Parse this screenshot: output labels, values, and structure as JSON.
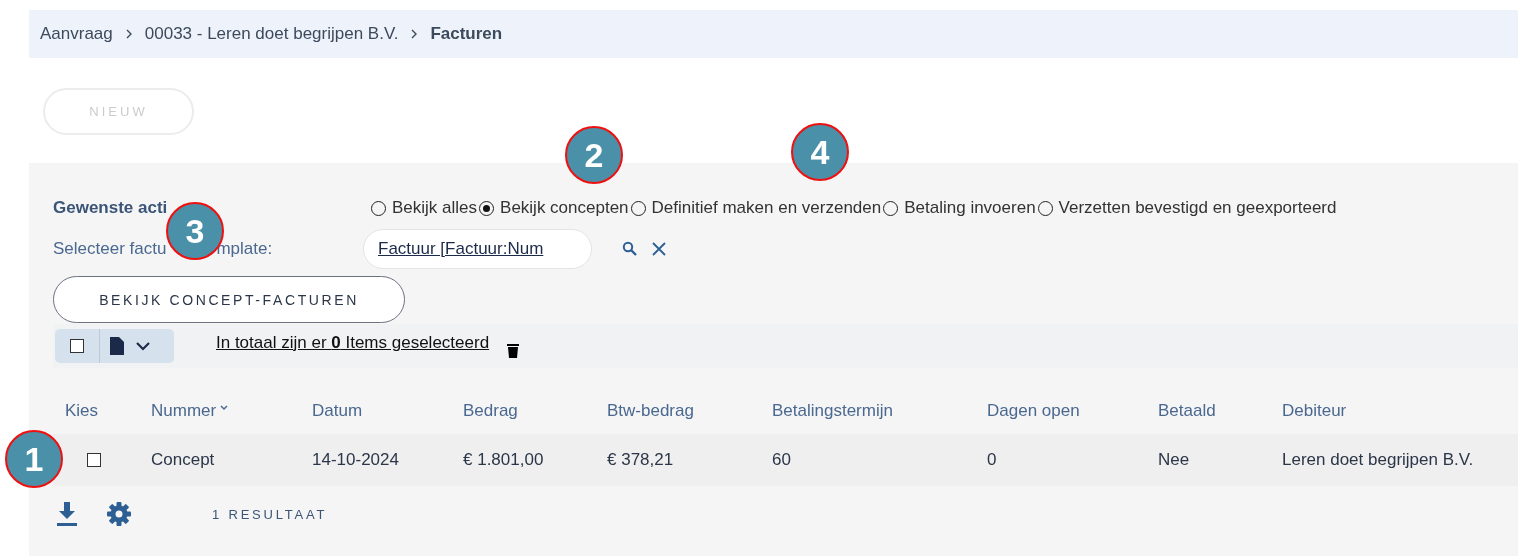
{
  "breadcrumb": [
    {
      "label": "Aanvraag",
      "current": false
    },
    {
      "label": "00033 - Leren doet begrijpen B.V.",
      "current": false
    },
    {
      "label": "Facturen",
      "current": true
    }
  ],
  "new_button": {
    "label": "NIEUW",
    "disabled": true
  },
  "action": {
    "label": "Gewenste acti",
    "options": [
      {
        "label": "Bekijk alles",
        "selected": false
      },
      {
        "label": "Bekijk concepten",
        "selected": true
      },
      {
        "label": "Definitief maken en verzenden",
        "selected": false
      },
      {
        "label": "Betaling invoeren",
        "selected": false
      },
      {
        "label": "Verzetten bevestigd en geexporteerd",
        "selected": false
      }
    ]
  },
  "template": {
    "label_parts": [
      "Selecteer factu",
      "mplate:"
    ],
    "value": "Factuur [Factuur:Num"
  },
  "view_button": "BEKIJK CONCEPT-FACTUREN",
  "selection": {
    "checked": false,
    "text": "In totaal zijn er **0** Items geselecteerd"
  },
  "table": {
    "columns": [
      "Kies",
      "Nummer",
      "Datum",
      "Bedrag",
      "Btw-bedrag",
      "Betalingstermijn",
      "Dagen open",
      "Betaald",
      "Debiteur"
    ],
    "rows": [
      {
        "checked": false,
        "cells": [
          "",
          "Concept",
          "14-10-2024",
          "€ 1.801,00",
          "€ 378,21",
          "60",
          "0",
          "Nee",
          "Leren doet begrijpen B.V."
        ]
      }
    ]
  },
  "result_count": "1 RESULTAAT",
  "callouts": [
    "1",
    "2",
    "3",
    "4"
  ]
}
